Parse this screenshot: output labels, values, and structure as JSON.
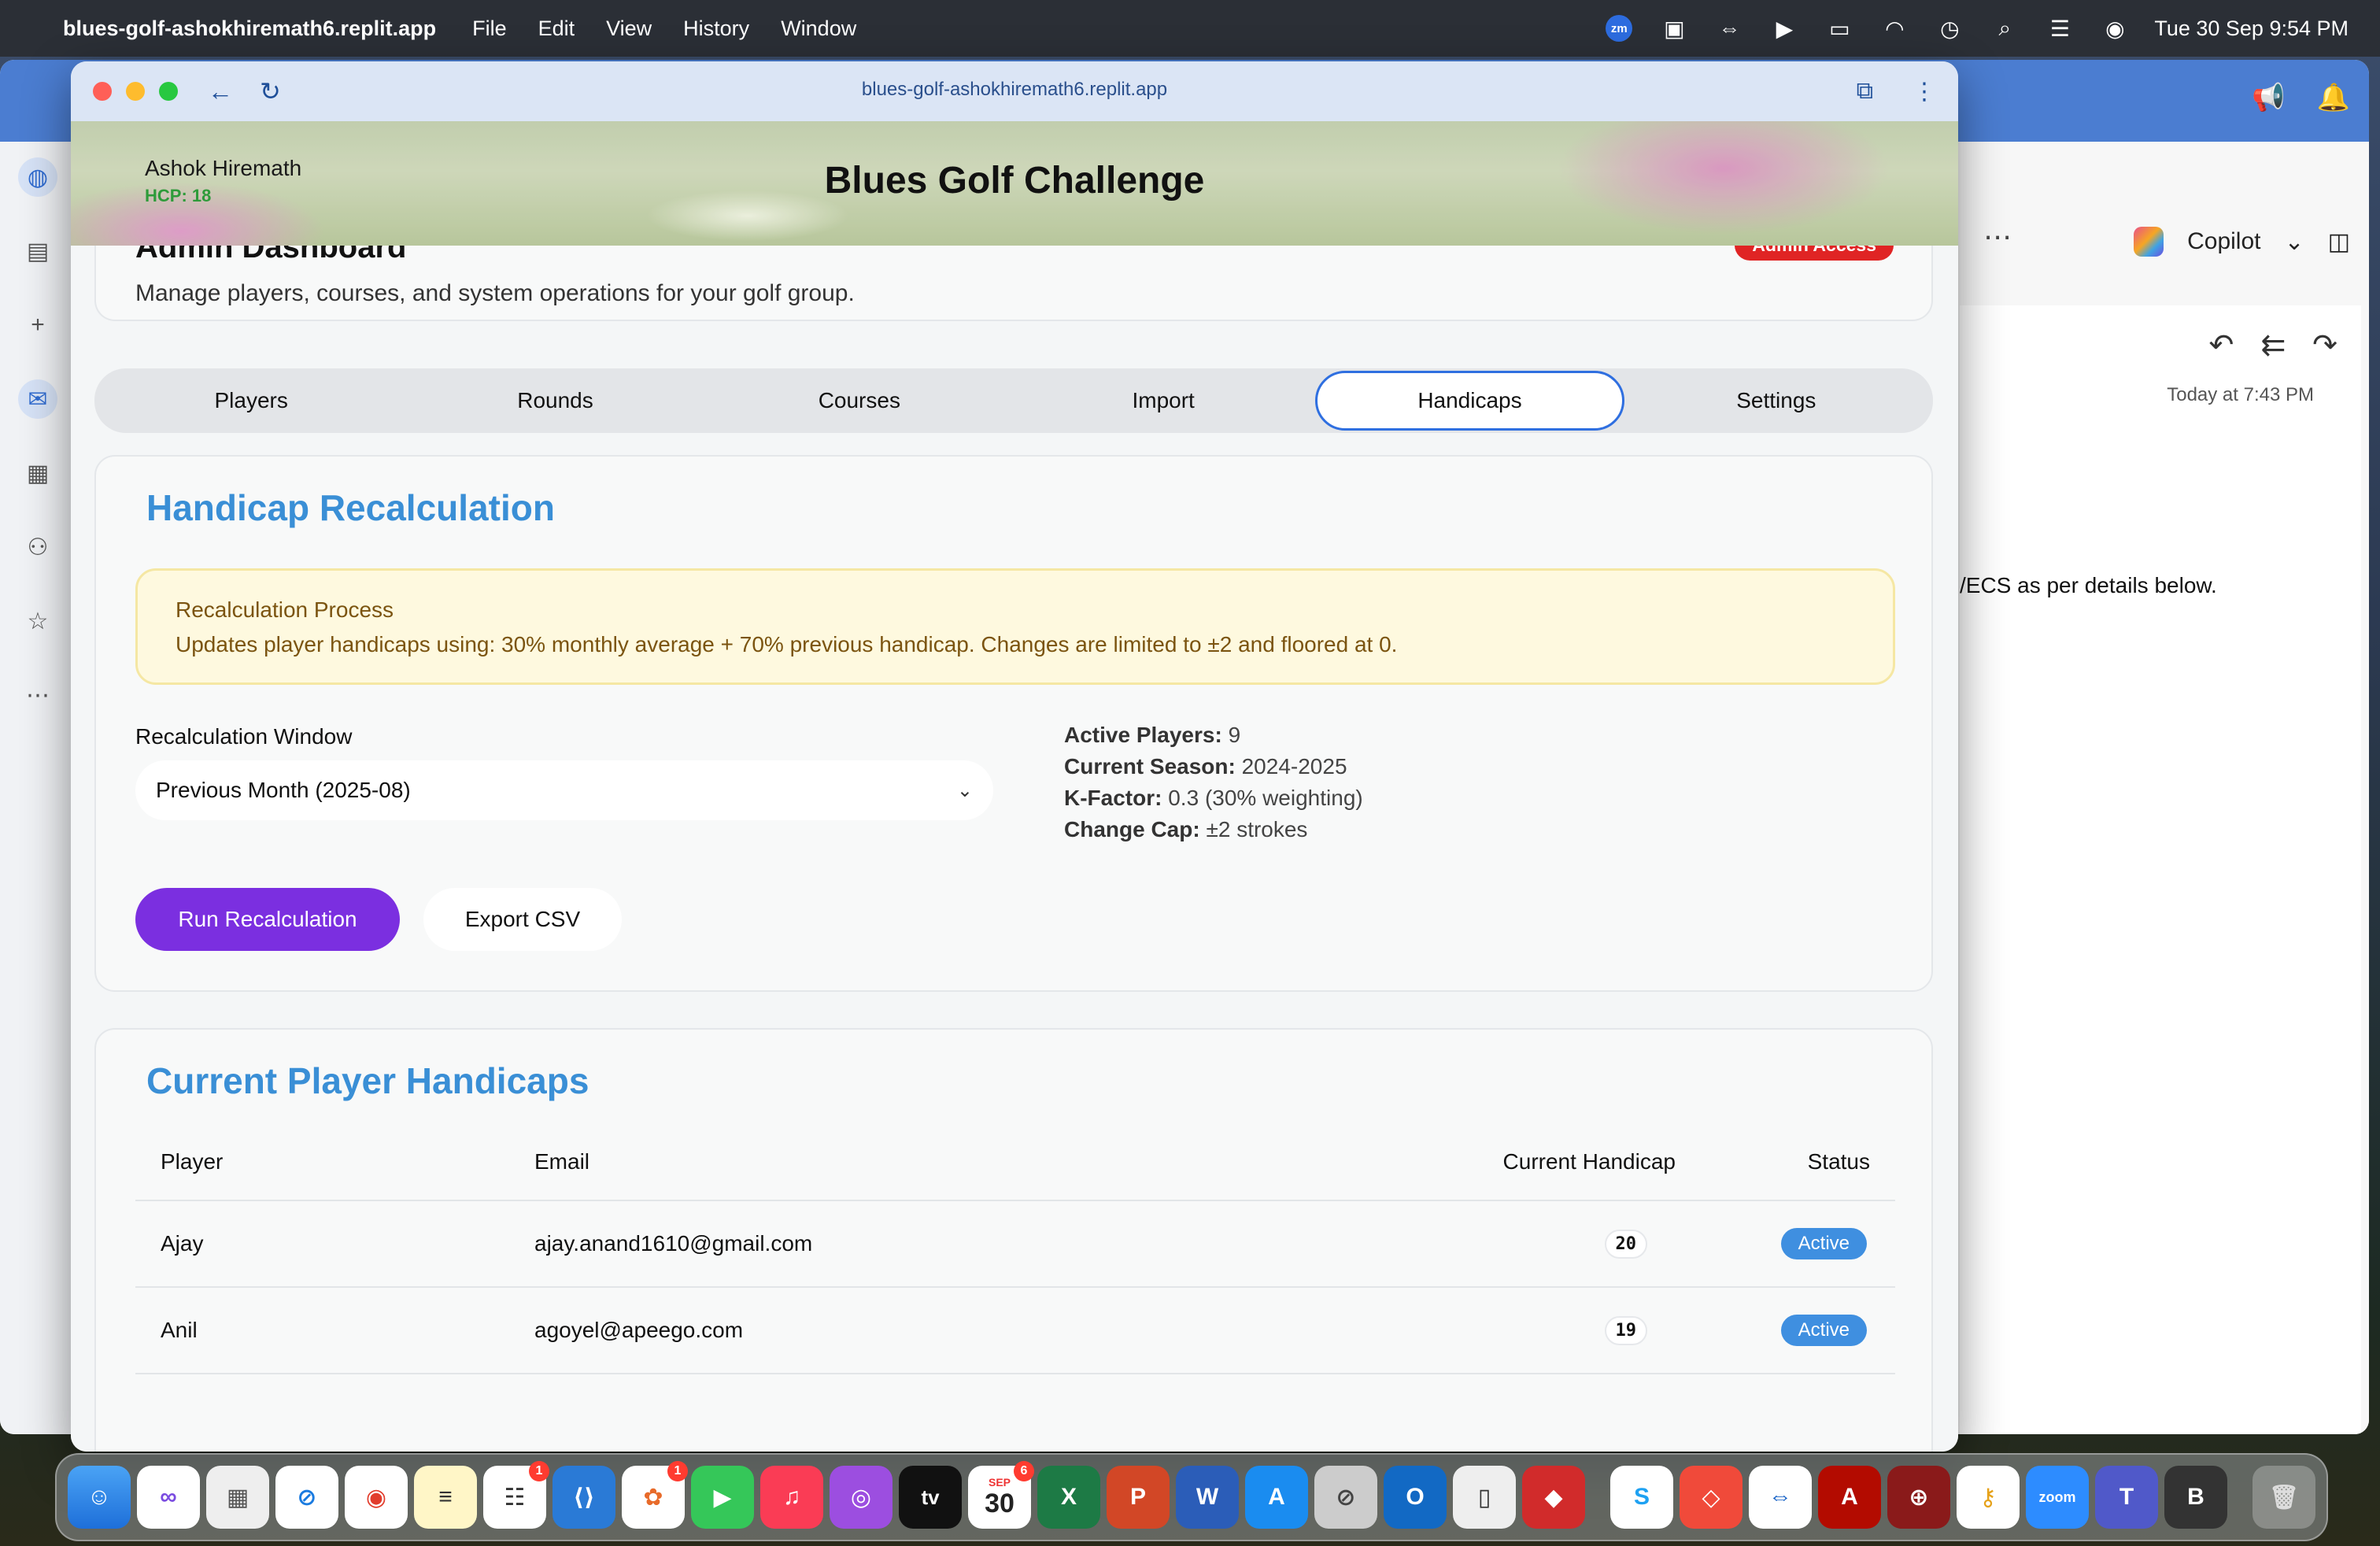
{
  "menubar": {
    "app_name": "blues-golf-ashokhiremath6.replit.app",
    "menus": [
      "File",
      "Edit",
      "View",
      "History",
      "Window"
    ],
    "zoom_label": "zm",
    "datetime": "Tue 30 Sep  9:54 PM"
  },
  "outlook": {
    "copilot_label": "Copilot",
    "time": "Today at 7:43 PM",
    "body_text": "/ECS as per details below."
  },
  "browser": {
    "url": "blues-golf-ashokhiremath6.replit.app"
  },
  "app": {
    "user_name": "Ashok Hiremath",
    "user_hcp": "HCP: 18",
    "title": "Blues Golf Challenge"
  },
  "admin": {
    "title": "Admin Dashboard",
    "badge": "Admin Access",
    "subtitle": "Manage players, courses, and system operations for your golf group."
  },
  "tabs": [
    {
      "label": "Players"
    },
    {
      "label": "Rounds"
    },
    {
      "label": "Courses"
    },
    {
      "label": "Import"
    },
    {
      "label": "Handicaps"
    },
    {
      "label": "Settings"
    }
  ],
  "active_tab": "Handicaps",
  "recalc": {
    "title": "Handicap Recalculation",
    "notice_title": "Recalculation Process",
    "notice_text": "Updates player handicaps using: 30% monthly average + 70% previous handicap. Changes are limited to ±2 and floored at 0.",
    "window_label": "Recalculation Window",
    "window_value": "Previous Month (2025-08)",
    "stats": {
      "active_players_label": "Active Players:",
      "active_players": "9",
      "season_label": "Current Season:",
      "season": "2024-2025",
      "kfactor_label": "K-Factor:",
      "kfactor": "0.3 (30% weighting)",
      "cap_label": "Change Cap:",
      "cap": "±2 strokes"
    },
    "run_button": "Run Recalculation",
    "export_button": "Export CSV"
  },
  "players": {
    "title": "Current Player Handicaps",
    "columns": [
      "Player",
      "Email",
      "Current Handicap",
      "Status"
    ],
    "rows": [
      {
        "player": "Ajay",
        "email": "ajay.anand1610@gmail.com",
        "handicap": "20",
        "status": "Active"
      },
      {
        "player": "Anil",
        "email": "agoyel@apeego.com",
        "handicap": "19",
        "status": "Active"
      }
    ]
  },
  "dock": {
    "calendar_month": "SEP",
    "calendar_day": "30",
    "badges": {
      "reminders": "1",
      "photos": "1",
      "calendar": "6"
    },
    "labels": {
      "tv": "tv",
      "zoom": "zoom",
      "bbedit": "B"
    }
  }
}
